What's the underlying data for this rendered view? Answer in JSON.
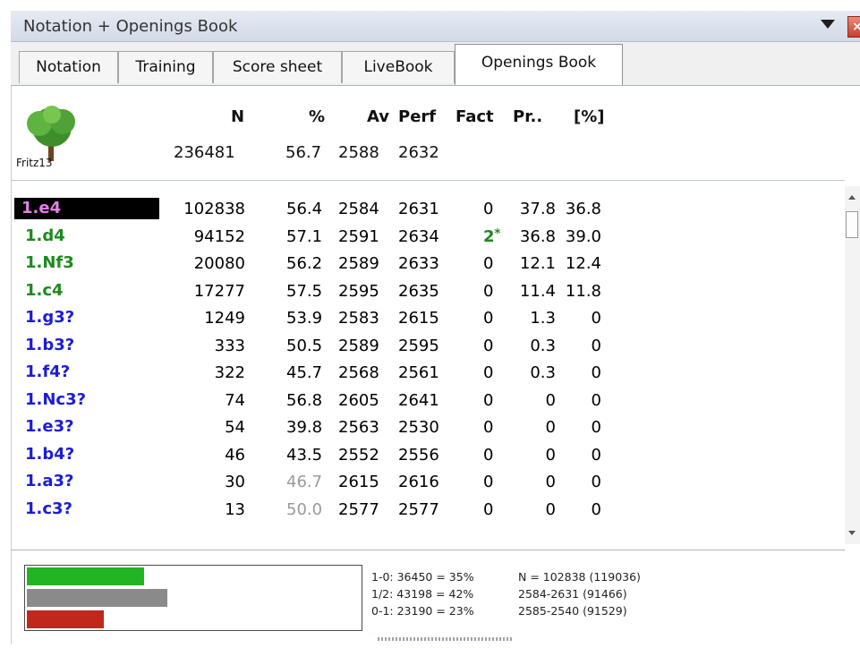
{
  "window": {
    "title": "Notation + Openings Book",
    "dropdown_icon": "triangle-down-icon",
    "close_icon": "close-icon"
  },
  "tabs": [
    {
      "label": "Notation",
      "active": false
    },
    {
      "label": "Training",
      "active": false
    },
    {
      "label": "Score sheet",
      "active": false
    },
    {
      "label": "LiveBook",
      "active": false
    },
    {
      "label": "Openings Book",
      "active": true
    }
  ],
  "book": {
    "name": "Fritz13",
    "icon": "tree-icon",
    "headers": {
      "n": "N",
      "pct": "%",
      "av": "Av",
      "perf": "Perf",
      "fact": "Fact",
      "pr": "Pr..",
      "bpct": "[%]"
    },
    "totals": {
      "n": "236481",
      "pct": "56.7",
      "av": "2588",
      "perf": "2632"
    }
  },
  "colors": {
    "good_move": "#1c8a1c",
    "dubious_move": "#1c1cd6",
    "selected_move_text": "#e082e6",
    "selected_bg": "#000000",
    "greyed_value": "#9a9a9a",
    "white_wins_bar": "#22b422",
    "draw_bar": "#8a8a8a",
    "black_wins_bar": "#c0281c"
  },
  "moves": [
    {
      "move": "1.e4",
      "n": "102838",
      "pct": "56.4",
      "av": "2584",
      "perf": "2631",
      "fact": "0",
      "pr": "37.8",
      "bpct": "36.8",
      "type": "selected",
      "greyed_pct": false,
      "star": ""
    },
    {
      "move": "1.d4",
      "n": "94152",
      "pct": "57.1",
      "av": "2591",
      "perf": "2634",
      "fact": "2",
      "pr": "36.8",
      "bpct": "39.0",
      "type": "good",
      "greyed_pct": false,
      "star": "*"
    },
    {
      "move": "1.Nf3",
      "n": "20080",
      "pct": "56.2",
      "av": "2589",
      "perf": "2633",
      "fact": "0",
      "pr": "12.1",
      "bpct": "12.4",
      "type": "good",
      "greyed_pct": false,
      "star": ""
    },
    {
      "move": "1.c4",
      "n": "17277",
      "pct": "57.5",
      "av": "2595",
      "perf": "2635",
      "fact": "0",
      "pr": "11.4",
      "bpct": "11.8",
      "type": "good",
      "greyed_pct": false,
      "star": ""
    },
    {
      "move": "1.g3?",
      "n": "1249",
      "pct": "53.9",
      "av": "2583",
      "perf": "2615",
      "fact": "0",
      "pr": "1.3",
      "bpct": "0",
      "type": "dubious",
      "greyed_pct": false,
      "star": ""
    },
    {
      "move": "1.b3?",
      "n": "333",
      "pct": "50.5",
      "av": "2589",
      "perf": "2595",
      "fact": "0",
      "pr": "0.3",
      "bpct": "0",
      "type": "dubious",
      "greyed_pct": false,
      "star": ""
    },
    {
      "move": "1.f4?",
      "n": "322",
      "pct": "45.7",
      "av": "2568",
      "perf": "2561",
      "fact": "0",
      "pr": "0.3",
      "bpct": "0",
      "type": "dubious",
      "greyed_pct": false,
      "star": ""
    },
    {
      "move": "1.Nc3?",
      "n": "74",
      "pct": "56.8",
      "av": "2605",
      "perf": "2641",
      "fact": "0",
      "pr": "0",
      "bpct": "0",
      "type": "dubious",
      "greyed_pct": false,
      "star": ""
    },
    {
      "move": "1.e3?",
      "n": "54",
      "pct": "39.8",
      "av": "2563",
      "perf": "2530",
      "fact": "0",
      "pr": "0",
      "bpct": "0",
      "type": "dubious",
      "greyed_pct": false,
      "star": ""
    },
    {
      "move": "1.b4?",
      "n": "46",
      "pct": "43.5",
      "av": "2552",
      "perf": "2556",
      "fact": "0",
      "pr": "0",
      "bpct": "0",
      "type": "dubious",
      "greyed_pct": false,
      "star": ""
    },
    {
      "move": "1.a3?",
      "n": "30",
      "pct": "46.7",
      "av": "2615",
      "perf": "2616",
      "fact": "0",
      "pr": "0",
      "bpct": "0",
      "type": "dubious",
      "greyed_pct": true,
      "star": ""
    },
    {
      "move": "1.c3?",
      "n": "13",
      "pct": "50.0",
      "av": "2577",
      "perf": "2577",
      "fact": "0",
      "pr": "0",
      "bpct": "0",
      "type": "dubious",
      "greyed_pct": true,
      "star": ""
    }
  ],
  "scrollbar": {
    "up_icon": "scroll-up-arrow-icon",
    "down_icon": "scroll-down-arrow-icon"
  },
  "stats": {
    "white_wins": "1-0: 36450 = 35%",
    "draws": "1/2: 43198 = 42%",
    "black_wins": "0-1: 23190 = 23%",
    "n_total": "N = 102838 (119036)",
    "rating_white": "2584-2631 (91466)",
    "rating_black": "2585-2540 (91529)",
    "bars": {
      "white_wins_pct": 35,
      "draws_pct": 42,
      "black_wins_pct": 23
    }
  }
}
